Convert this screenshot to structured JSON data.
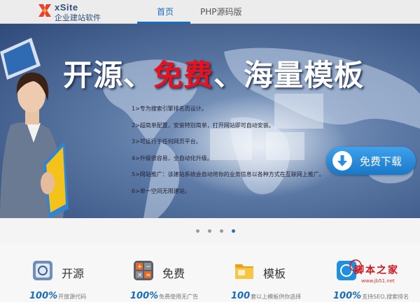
{
  "header": {
    "logo_name": "xSite",
    "logo_sub": "企业建站软件",
    "nav": {
      "home": "首页",
      "php": "PHP源码版"
    }
  },
  "banner": {
    "headline_part1": "开源、",
    "headline_red": "免费",
    "headline_part2": "、海量模板",
    "features": [
      "1>专为搜索引擎排名而设计。",
      "2>超简单配置，安装特别简单，打开网站即可自动安装。",
      "3>可运行于任何网页平台。",
      "4>升级很容易，全自动化升级。",
      "5>网站推广：该建站系统会自动将你的业务信息以各种方式在互联网上推广。",
      "6>单一空间无限建站。"
    ],
    "download_label": "免费下载",
    "slides_total": 4,
    "slide_active": 4
  },
  "features_bar": [
    {
      "icon": "finder-icon",
      "title": "开源",
      "pct": "100%",
      "desc": "开放源代码"
    },
    {
      "icon": "calculator-icon",
      "title": "免费",
      "pct": "100%",
      "desc": "免费使用无广告"
    },
    {
      "icon": "folder-icon",
      "title": "模板",
      "pct": "100",
      "desc": "套以上模板供你选择"
    },
    {
      "icon": "seo-icon",
      "title": "",
      "pct": "100%",
      "desc": "支持SEO,搜索排名"
    }
  ],
  "watermark": {
    "text": "脚本之家",
    "url": "www.jb51.net"
  },
  "colors": {
    "accent": "#1b6bbd",
    "red": "#e8121e",
    "button": "#2a8ee0"
  }
}
